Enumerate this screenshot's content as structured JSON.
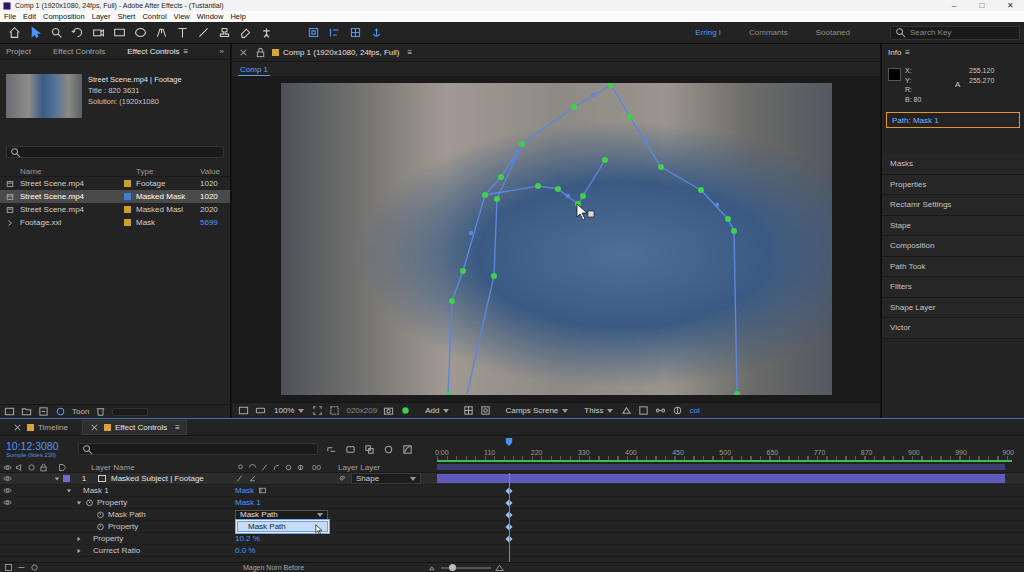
{
  "window": {
    "title": "Comp 1 (1920x1080, 24fps, Full) - Adobe After Effects - (Tustantial)",
    "controls": [
      "–",
      "□",
      "✕"
    ]
  },
  "menu": [
    "File",
    "Edit",
    "Composition",
    "Layer",
    "Shert",
    "Control",
    "View",
    "Window",
    "Help"
  ],
  "toolbar": {
    "workspaces": [
      {
        "label": "Erring I",
        "selected": true
      },
      {
        "label": "Commants",
        "selected": false
      },
      {
        "label": "Sootaned",
        "selected": false
      }
    ],
    "search": {
      "placeholder": "Search Key"
    }
  },
  "project": {
    "tabs": [
      {
        "label": "Project",
        "selected": false
      },
      {
        "label": "Effect Controls",
        "selected": false
      },
      {
        "label": "Effect Controls",
        "selected": true
      }
    ],
    "tab_menu": "≡",
    "overflow": "»",
    "asset": {
      "name": "Street Scene.mp4 | Footage",
      "details": [
        "Title : 820 3631",
        "Solution: (1920x1080"
      ]
    },
    "columns": [
      "Name",
      "Type",
      "Value"
    ],
    "rows": [
      {
        "name": "Street Scene.mp4",
        "type": "Footage",
        "value": "1020",
        "color": "#c9a227",
        "kind": "file",
        "selected": false
      },
      {
        "name": "Street Scene.mp4",
        "type": "Masked Mask",
        "value": "1020",
        "color": "#3b82d6",
        "kind": "file",
        "selected": true
      },
      {
        "name": "Street Scene.mp4",
        "type": "Masked Masl",
        "value": "2020",
        "color": "#c9a227",
        "kind": "file",
        "selected": false
      },
      {
        "name": "Footage.xxl",
        "type": "Mask",
        "value": "5699",
        "color": "#c9a227",
        "kind": "folder",
        "selected": false
      }
    ],
    "footer": "Toon"
  },
  "composition": {
    "tab": "Comp 1 (1920x1080, 24fps, Full)",
    "tab_menu": "≡",
    "subtab": "Comp 1",
    "viewer_bar": {
      "zoom": "100%",
      "resolution": "020x209",
      "mode": "Add",
      "view": "Camps Screne",
      "renderer": "Thiss",
      "extra": "col"
    }
  },
  "info": {
    "title": "Info",
    "menu": "≡",
    "labels": [
      "X:",
      "Y:",
      "R:",
      "B: 80"
    ],
    "values": [
      "255.120",
      "255.270"
    ],
    "alpha": "A",
    "path": "Path: Mask 1"
  },
  "panels": [
    "Masks",
    "Properties",
    "Rectamr Settings",
    "Stape",
    "Composition",
    "Path Took",
    "Filters",
    "Shape Layer",
    "Victor"
  ],
  "timeline": {
    "tabs": [
      {
        "label": "Timeline",
        "selected": false
      },
      {
        "label": "Effect Controls",
        "selected": true
      }
    ],
    "tab_menu": "≡",
    "timecode": "10:12:3080",
    "fps": "Sumple (fittes 23fl)",
    "columns": {
      "name": "Layer Name",
      "switches": "00",
      "parent": "Layer Layer"
    },
    "ruler": [
      "0:00",
      "110",
      "220",
      "330",
      "400",
      "450",
      "500",
      "650",
      "770",
      "870",
      "900",
      "990",
      "900"
    ],
    "playhead": {
      "level": 0.13
    },
    "rows": [
      {
        "kind": "layer",
        "number": "1",
        "name": "Masked Subject | Footage",
        "expanded": true,
        "eye": true,
        "value": "",
        "parent": "Shape",
        "keyframe": false
      },
      {
        "kind": "mask",
        "name": "Mask 1",
        "expanded": true,
        "eye": true,
        "value": "Mask",
        "keyframe": true
      },
      {
        "kind": "section",
        "name": "Property",
        "expanded": true,
        "eye": true,
        "value": "Mask 1",
        "keyframe": true
      },
      {
        "kind": "property",
        "name": "Mask Path",
        "eye": false,
        "value": "",
        "dropdown": {
          "value": "Mask Path",
          "open": true,
          "options": [
            {
              "label": "Mask Path",
              "selected": true
            }
          ]
        },
        "keyframe": true
      },
      {
        "kind": "property",
        "name": "Property",
        "eye": false,
        "value": "",
        "keyframe": true
      },
      {
        "kind": "folded",
        "name": "Property",
        "expanded": false,
        "eye": false,
        "value": "10.2 %",
        "keyframe": true
      },
      {
        "kind": "folded",
        "name": "Currect Ratio",
        "expanded": false,
        "eye": false,
        "value": "0.0 %",
        "keyframe": false
      }
    ],
    "footer": "Magen Norn Before"
  }
}
